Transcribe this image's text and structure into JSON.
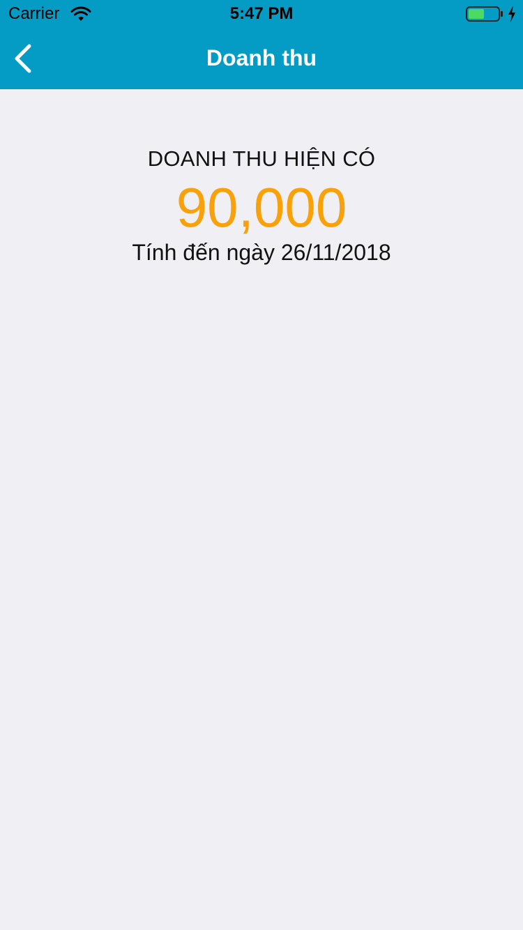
{
  "status_bar": {
    "carrier": "Carrier",
    "time": "5:47 PM",
    "battery_color": "#4cd964"
  },
  "nav_bar": {
    "title": "Doanh thu",
    "back_icon": "chevron-left-icon",
    "background_color": "#049cc4"
  },
  "revenue": {
    "label": "DOANH THU HIỆN CÓ",
    "value": "90,000",
    "value_color": "#f9a10a",
    "as_of": "Tính đến ngày 26/11/2018"
  }
}
